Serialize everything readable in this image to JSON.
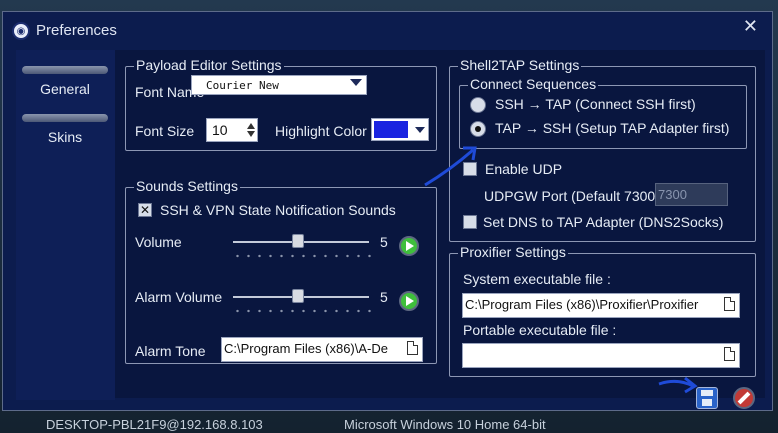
{
  "window": {
    "title": "Preferences",
    "close_glyph": "✕"
  },
  "taskbar": {
    "host": "DESKTOP-PBL21F9@192.168.8.103",
    "os": "Microsoft Windows 10 Home 64-bit"
  },
  "sidebar": {
    "items": [
      {
        "label": "General"
      },
      {
        "label": "Skins"
      }
    ]
  },
  "payload_editor": {
    "title": "Payload Editor Settings",
    "font_name_label": "Font Name",
    "font_name_value": "Courier New",
    "font_size_label": "Font Size",
    "font_size_value": "10",
    "highlight_color_label": "Highlight Color",
    "highlight_color": "#1a24e0"
  },
  "sounds": {
    "title": "Sounds Settings",
    "notification_label": "SSH & VPN State Notification Sounds",
    "notification_checked": true,
    "checkbox_glyph": "✕",
    "volume_label": "Volume",
    "volume_value": "5",
    "alarm_volume_label": "Alarm Volume",
    "alarm_volume_value": "5",
    "alarm_tone_label": "Alarm Tone",
    "alarm_tone_value": "C:\\Program Files (x86)\\A-De"
  },
  "shell2tap": {
    "title": "Shell2TAP Settings",
    "connect_sequences_title": "Connect Sequences",
    "options": [
      {
        "label": "SSH → TAP (Connect SSH first)",
        "selected": false
      },
      {
        "label": "TAP → SSH (Setup TAP Adapter first)",
        "selected": true
      }
    ],
    "enable_udp_label": "Enable UDP",
    "enable_udp_checked": false,
    "udpgw_port_label": "UDPGW Port (Default 7300)",
    "udpgw_port_value": "7300",
    "set_dns_label": "Set DNS to TAP Adapter (DNS2Socks)",
    "set_dns_checked": false
  },
  "proxifier": {
    "title": "Proxifier Settings",
    "system_label": "System executable file :",
    "system_value": "C:\\Program Files (x86)\\Proxifier\\Proxifier",
    "portable_label": "Portable executable file :",
    "portable_value": ""
  },
  "icons": {
    "app": "app-logo-icon",
    "play": "play-icon",
    "file": "file-browse-icon",
    "save": "save-icon",
    "cancel": "cancel-icon"
  },
  "colors": {
    "window_bg": "#0c1c4e",
    "content_bg": "#09163f",
    "play_green": "#3fbf3c",
    "cancel_red": "#c23a36",
    "annotation_arrow": "#1f4bd8"
  }
}
